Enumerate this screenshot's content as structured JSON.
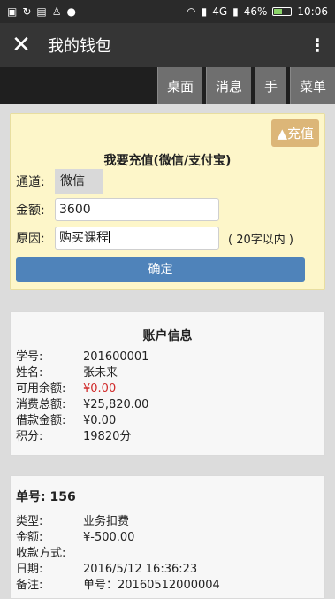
{
  "status_bar": {
    "battery_percent": "46%",
    "time": "10:06",
    "network": "4G",
    "battery_level": 0.46
  },
  "app_bar": {
    "title": "我的钱包"
  },
  "nav": [
    "桌面",
    "消息",
    "手",
    "菜单"
  ],
  "topup": {
    "toggle_label": "▲充值",
    "heading": "我要充值(微信/支付宝)",
    "channel_label": "通道:",
    "channel_value": "微信",
    "amount_label": "金额:",
    "amount_value": "3600",
    "reason_label": "原因:",
    "reason_value": "购买课程",
    "reason_hint": "( 20字以内 )",
    "confirm_label": "确定"
  },
  "account": {
    "heading": "账户信息",
    "rows": [
      {
        "label": "学号:",
        "value": "201600001"
      },
      {
        "label": "姓名:",
        "value": "张未来"
      },
      {
        "label": "可用余额:",
        "value": "¥0.00"
      },
      {
        "label": "消费总额:",
        "value": "¥25,820.00"
      },
      {
        "label": "借款金额:",
        "value": "¥0.00"
      },
      {
        "label": "积分:",
        "value": "19820分"
      }
    ],
    "highlight_color": "#d02a2a"
  },
  "order": {
    "number_text": "单号: 156",
    "rows": [
      {
        "label": "类型:",
        "value": "业务扣费"
      },
      {
        "label": "金额:",
        "value": "¥-500.00"
      },
      {
        "label": "收款方式:",
        "value": ""
      },
      {
        "label": "日期:",
        "value": "2016/5/12 16:36:23"
      },
      {
        "label": "备注:",
        "value": "单号：20160512000004"
      }
    ]
  },
  "colors": {
    "topup_bg": "#fdf6c9",
    "confirm_bg": "#4f83ba",
    "toggle_bg": "#dcb678",
    "appbar_bg": "#353535"
  }
}
